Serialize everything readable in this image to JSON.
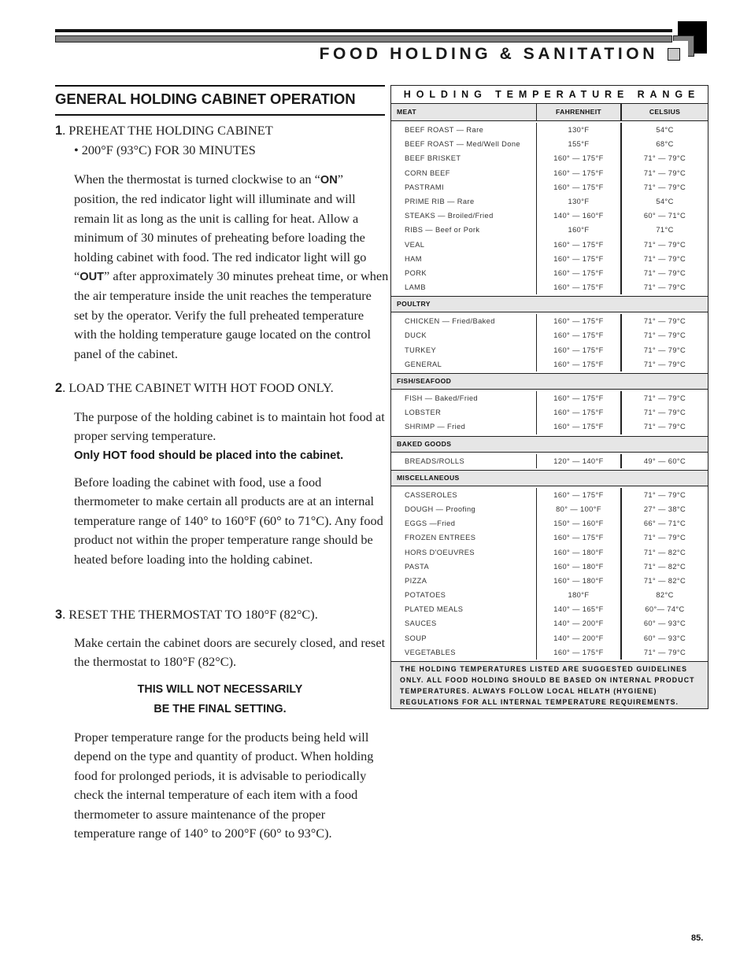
{
  "header": {
    "title": "FOOD HOLDING & SANITATION"
  },
  "section": {
    "title": "GENERAL HOLDING CABINET OPERATION"
  },
  "steps": [
    {
      "number": "1",
      "heading": "PREHEAT THE HOLDING CABINET",
      "bullet": "• 200°F (93°C) FOR 30 MINUTES",
      "paragraph": {
        "part1": "When the thermostat is turned clockwise to an “",
        "bold1": "ON",
        "part2": "” position, the red indicator light will illuminate and will remain lit as long as the unit is calling for heat.  Allow a minimum of 30 minutes of preheating before loading the holding cabinet with food.  The red indicator light will go “",
        "bold2": "OUT",
        "part3": "” after approximately 30 minutes preheat time, or when the air temperature inside the unit reaches the temperature set by the operator.  Verify the full preheated temperature with the holding temperature gauge located on the control panel of the cabinet."
      }
    },
    {
      "number": "2",
      "heading": "LOAD THE CABINET WITH HOT FOOD ONLY.",
      "paragraph1": "The purpose of the holding cabinet is to maintain hot food at proper serving temperature.",
      "bold_line": "Only HOT food should be placed into the cabinet.",
      "paragraph2": "Before loading the cabinet with food, use a food thermometer to make certain all products are at an internal temperature range of 140° to 160°F (60° to 71°C).  Any food product not within the proper temperature range should be heated before loading into the holding cabinet."
    },
    {
      "number": "3",
      "heading": "RESET THE THERMOSTAT TO 180°F (82°C).",
      "paragraph1": "Make certain the cabinet doors are securely closed, and reset the thermostat to 180°F (82°C).",
      "warning_line1": "THIS WILL NOT NECESSARILY",
      "warning_line2": "BE THE FINAL SETTING.",
      "paragraph2": "Proper temperature range for the products being held will depend on the type and quantity of product.  When holding food for prolonged periods, it is advisable to periodically check the internal temperature of each item with a food thermometer to assure maintenance of the proper temperature range of 140° to 200°F (60° to 93°C)."
    }
  ],
  "table": {
    "title": "HOLDING TEMPERATURE RANGE",
    "col_fahrenheit": "FAHRENHEIT",
    "col_celsius": "CELSIUS",
    "categories": [
      {
        "name": "MEAT",
        "items": [
          {
            "name": "BEEF ROAST — Rare",
            "f": "130°F",
            "c": "54°C"
          },
          {
            "name": "BEEF ROAST — Med/Well Done",
            "f": "155°F",
            "c": "68°C"
          },
          {
            "name": "BEEF BRISKET",
            "f": "160° — 175°F",
            "c": "71° — 79°C"
          },
          {
            "name": "CORN BEEF",
            "f": "160° — 175°F",
            "c": "71° — 79°C"
          },
          {
            "name": "PASTRAMI",
            "f": "160° — 175°F",
            "c": "71° — 79°C"
          },
          {
            "name": "PRIME RIB — Rare",
            "f": "130°F",
            "c": "54°C"
          },
          {
            "name": "STEAKS — Broiled/Fried",
            "f": "140° — 160°F",
            "c": "60° — 71°C"
          },
          {
            "name": "RIBS — Beef or Pork",
            "f": "160°F",
            "c": "71°C"
          },
          {
            "name": "VEAL",
            "f": "160° — 175°F",
            "c": "71° — 79°C"
          },
          {
            "name": "HAM",
            "f": "160° — 175°F",
            "c": "71° — 79°C"
          },
          {
            "name": "PORK",
            "f": "160° — 175°F",
            "c": "71° — 79°C"
          },
          {
            "name": "LAMB",
            "f": "160° — 175°F",
            "c": "71° — 79°C"
          }
        ]
      },
      {
        "name": "POULTRY",
        "items": [
          {
            "name": "CHICKEN — Fried/Baked",
            "f": "160° — 175°F",
            "c": "71° — 79°C"
          },
          {
            "name": "DUCK",
            "f": "160° — 175°F",
            "c": "71° — 79°C"
          },
          {
            "name": "TURKEY",
            "f": "160° — 175°F",
            "c": "71° — 79°C"
          },
          {
            "name": "GENERAL",
            "f": "160° — 175°F",
            "c": "71° — 79°C"
          }
        ]
      },
      {
        "name": "FISH/SEAFOOD",
        "items": [
          {
            "name": "FISH — Baked/Fried",
            "f": "160° — 175°F",
            "c": "71° — 79°C"
          },
          {
            "name": "LOBSTER",
            "f": "160° — 175°F",
            "c": "71° — 79°C"
          },
          {
            "name": "SHRIMP — Fried",
            "f": "160° — 175°F",
            "c": "71° — 79°C"
          }
        ]
      },
      {
        "name": "BAKED GOODS",
        "items": [
          {
            "name": "BREADS/ROLLS",
            "f": "120° — 140°F",
            "c": "49° — 60°C"
          }
        ]
      },
      {
        "name": "MISCELLANEOUS",
        "items": [
          {
            "name": "CASSEROLES",
            "f": "160° — 175°F",
            "c": "71° — 79°C"
          },
          {
            "name": "DOUGH — Proofing",
            "f": "80° — 100°F",
            "c": "27° — 38°C"
          },
          {
            "name": "EGGS —Fried",
            "f": "150° — 160°F",
            "c": "66° — 71°C"
          },
          {
            "name": "FROZEN ENTREES",
            "f": "160° — 175°F",
            "c": "71° — 79°C"
          },
          {
            "name": "HORS D'OEUVRES",
            "f": "160° — 180°F",
            "c": "71° — 82°C"
          },
          {
            "name": "PASTA",
            "f": "160° — 180°F",
            "c": "71° — 82°C"
          },
          {
            "name": "PIZZA",
            "f": "160° — 180°F",
            "c": "71° — 82°C"
          },
          {
            "name": "POTATOES",
            "f": "180°F",
            "c": "82°C"
          },
          {
            "name": "PLATED MEALS",
            "f": "140° — 165°F",
            "c": "60°— 74°C"
          },
          {
            "name": "SAUCES",
            "f": "140° — 200°F",
            "c": "60° — 93°C"
          },
          {
            "name": "SOUP",
            "f": "140° — 200°F",
            "c": "60° — 93°C"
          },
          {
            "name": "VEGETABLES",
            "f": "160° — 175°F",
            "c": "71° — 79°C"
          }
        ]
      }
    ],
    "note": "THE HOLDING TEMPERATURES LISTED ARE SUGGESTED GUIDELINES ONLY.  ALL FOOD HOLDING SHOULD BE BASED ON INTERNAL PRODUCT TEMPERATURES.  ALWAYS FOLLOW LOCAL HELATH (HYGIENE) REGULATIONS FOR ALL INTERNAL TEMPERATURE REQUIREMENTS."
  },
  "footer": {
    "page_number": "85."
  }
}
